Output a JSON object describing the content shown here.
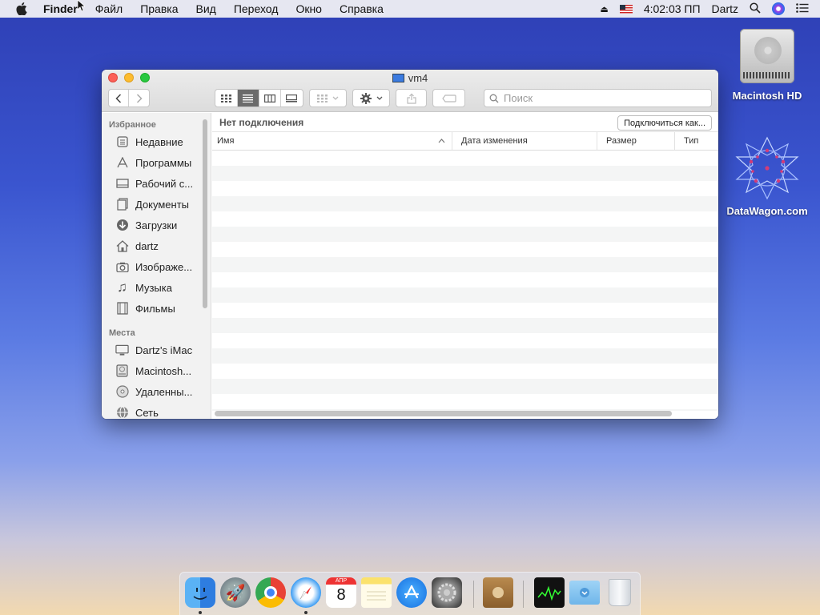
{
  "menubar": {
    "app": "Finder",
    "menus": [
      "Файл",
      "Правка",
      "Вид",
      "Переход",
      "Окно",
      "Справка"
    ],
    "time": "4:02:03 ПП",
    "user": "Dartz"
  },
  "desktop": {
    "icons": [
      {
        "label": "Macintosh HD"
      },
      {
        "label": "DataWagon.com"
      }
    ]
  },
  "window": {
    "title": "vm4",
    "search_placeholder": "Поиск",
    "connection_status": "Нет подключения",
    "connect_button": "Подключиться как...",
    "columns": [
      "Имя",
      "Дата изменения",
      "Размер",
      "Тип"
    ]
  },
  "sidebar": {
    "favorites_header": "Избранное",
    "favorites": [
      {
        "label": "Недавние",
        "icon": "recents-icon"
      },
      {
        "label": "Программы",
        "icon": "applications-icon"
      },
      {
        "label": "Рабочий с...",
        "icon": "desktop-icon"
      },
      {
        "label": "Документы",
        "icon": "documents-icon"
      },
      {
        "label": "Загрузки",
        "icon": "downloads-icon"
      },
      {
        "label": "dartz",
        "icon": "home-icon"
      },
      {
        "label": "Изображе...",
        "icon": "pictures-icon"
      },
      {
        "label": "Музыка",
        "icon": "music-icon"
      },
      {
        "label": "Фильмы",
        "icon": "movies-icon"
      }
    ],
    "places_header": "Места",
    "places": [
      {
        "label": "Dartz's iMac",
        "icon": "imac-icon"
      },
      {
        "label": "Macintosh...",
        "icon": "disk-icon"
      },
      {
        "label": "Удаленны...",
        "icon": "remote-disc-icon"
      },
      {
        "label": "Сеть",
        "icon": "network-icon"
      }
    ]
  },
  "dock": {
    "calendar_month": "АПР",
    "calendar_day": "8",
    "items": [
      "finder",
      "launchpad",
      "chrome",
      "safari",
      "calendar",
      "notes",
      "app-store",
      "system-preferences",
      "contacts",
      "activity-monitor",
      "downloads-folder",
      "trash"
    ]
  }
}
